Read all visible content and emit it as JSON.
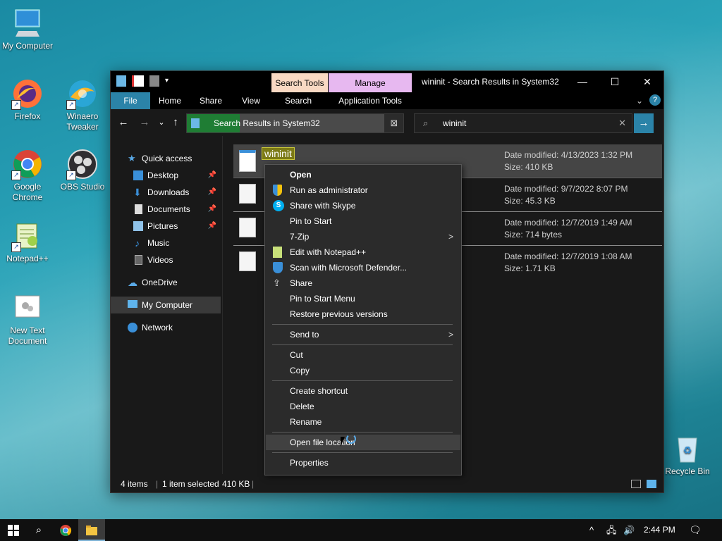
{
  "desktop": {
    "icons": [
      {
        "label": "My Computer"
      },
      {
        "label": "Firefox"
      },
      {
        "label": "Winaero Tweaker"
      },
      {
        "label": "Google Chrome"
      },
      {
        "label": "OBS Studio"
      },
      {
        "label": "Notepad++"
      },
      {
        "label": "New Text Document"
      },
      {
        "label": "Recycle Bin"
      }
    ]
  },
  "window": {
    "title": "wininit - Search Results in System32",
    "context_tabs": {
      "search_tools": "Search Tools",
      "manage": "Manage"
    },
    "ribbon_tabs": [
      "File",
      "Home",
      "Share",
      "View",
      "Search",
      "Application Tools"
    ],
    "address": "Search Results in System32",
    "search_value": "wininit",
    "help_icon": "question-icon"
  },
  "sidebar": {
    "items": [
      {
        "label": "Quick access"
      },
      {
        "label": "Desktop"
      },
      {
        "label": "Downloads"
      },
      {
        "label": "Documents"
      },
      {
        "label": "Pictures"
      },
      {
        "label": "Music"
      },
      {
        "label": "Videos"
      },
      {
        "label": "OneDrive"
      },
      {
        "label": "My Computer"
      },
      {
        "label": "Network"
      }
    ]
  },
  "files": [
    {
      "name": "wininit",
      "date": "Date modified: 4/13/2023 1:32 PM",
      "size": "Size: 410 KB"
    },
    {
      "date": "Date modified: 9/7/2022 8:07 PM",
      "size": "Size: 45.3 KB"
    },
    {
      "date": "Date modified: 12/7/2019 1:49 AM",
      "size": "Size: 714 bytes"
    },
    {
      "date": "Date modified: 12/7/2019 1:08 AM",
      "size": "Size: 1.71 KB"
    }
  ],
  "status": {
    "items": "4 items",
    "selected": "1 item selected",
    "size": "410 KB"
  },
  "context_menu": {
    "open": "Open",
    "run_admin": "Run as administrator",
    "share_skype": "Share with Skype",
    "pin_start": "Pin to Start",
    "seven_zip": "7-Zip",
    "edit_npp": "Edit with Notepad++",
    "scan_defender": "Scan with Microsoft Defender...",
    "share": "Share",
    "pin_start_menu": "Pin to Start Menu",
    "restore": "Restore previous versions",
    "send_to": "Send to",
    "cut": "Cut",
    "copy": "Copy",
    "create_shortcut": "Create shortcut",
    "delete": "Delete",
    "rename": "Rename",
    "open_location": "Open file location",
    "properties": "Properties"
  },
  "taskbar": {
    "time": "2:44 PM"
  }
}
